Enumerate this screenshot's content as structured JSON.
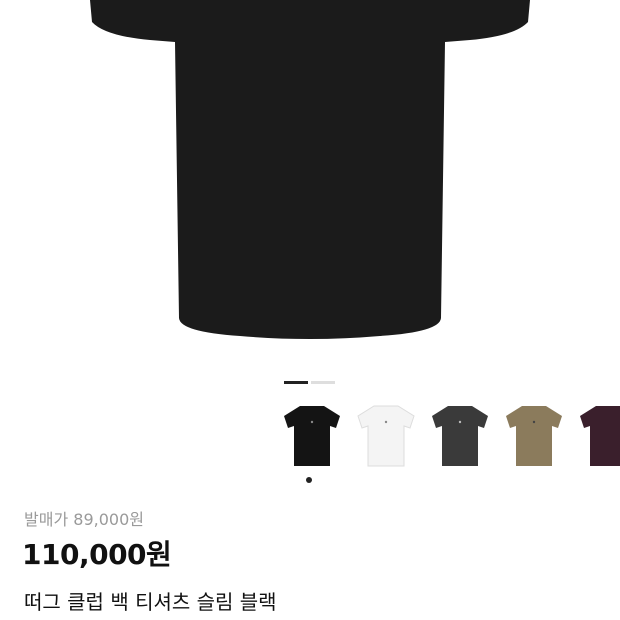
{
  "product": {
    "release_label": "발매가",
    "release_price": "89,000원",
    "price": "110,000원",
    "title": "떠그 클럽 백 티셔츠 슬림 블랙"
  },
  "image_pager": {
    "count": 2,
    "active_index": 0
  },
  "colors": {
    "shirt_main": "#1b1b1b",
    "variants": [
      "#141414",
      "#f4f4f4",
      "#3a3a3a",
      "#8b7b5c",
      "#3a1f2c"
    ]
  },
  "variants": [
    {
      "name": "black",
      "selected": true
    },
    {
      "name": "white",
      "selected": false
    },
    {
      "name": "charcoal",
      "selected": false
    },
    {
      "name": "khaki",
      "selected": false
    },
    {
      "name": "burgundy",
      "selected": false
    }
  ]
}
